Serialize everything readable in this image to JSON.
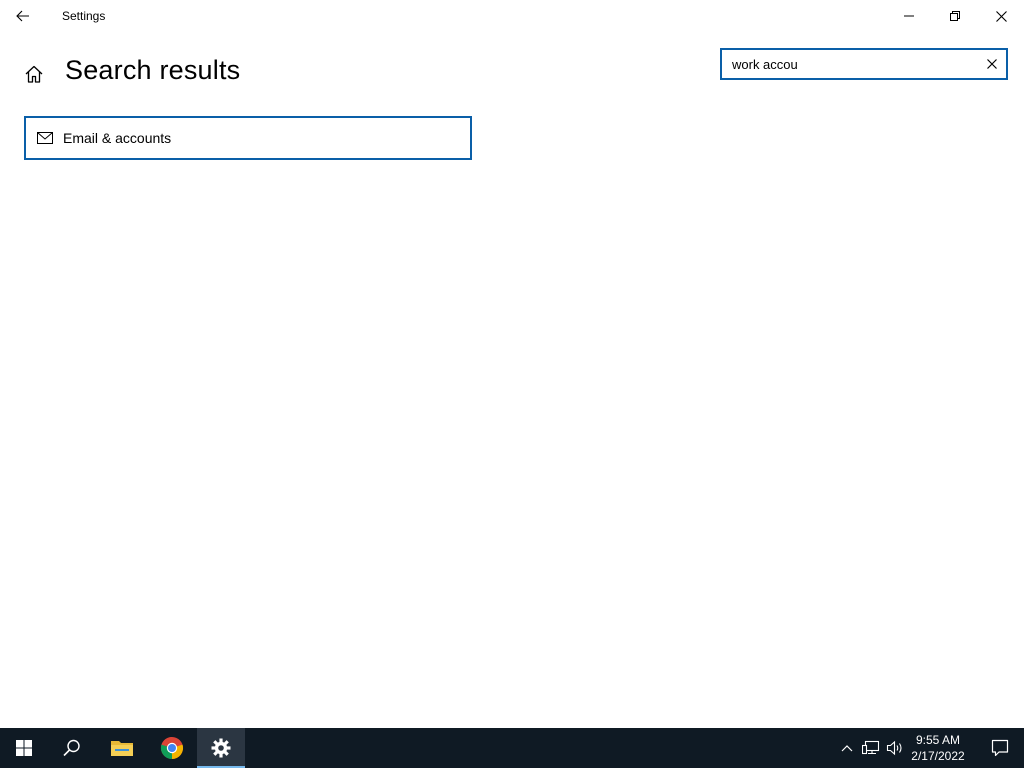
{
  "window": {
    "title": "Settings"
  },
  "header": {
    "page_title": "Search results"
  },
  "search": {
    "value": "work accou",
    "placeholder": ""
  },
  "results": [
    {
      "label": "Email & accounts",
      "icon": "mail-icon"
    }
  ],
  "taskbar": {
    "items": [
      "start-icon",
      "search-icon",
      "file-explorer-icon",
      "chrome-icon",
      "settings-icon"
    ],
    "active": "settings-icon"
  },
  "tray": {
    "time": "9:55 AM",
    "date": "2/17/2022"
  },
  "colors": {
    "accent": "#0a5fa8",
    "taskbar": "#0f1a24",
    "taskbar_active": "#2b3642",
    "active_indicator": "#76b9ed"
  }
}
